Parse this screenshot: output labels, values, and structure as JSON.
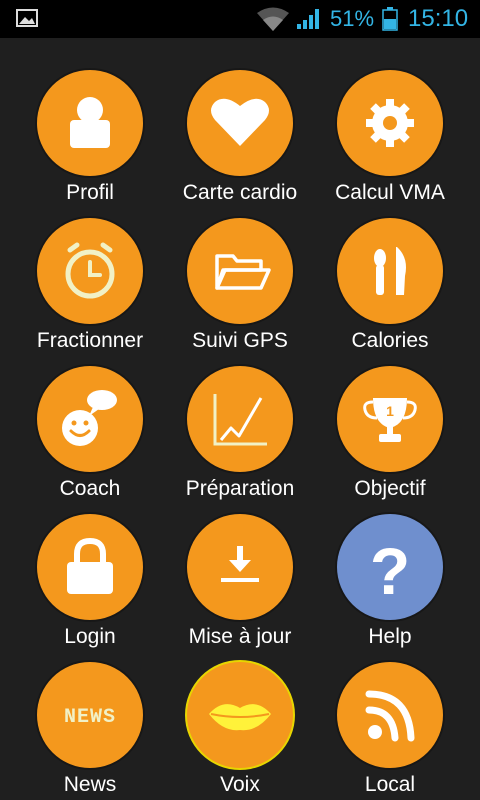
{
  "status_bar": {
    "battery_percent": "51%",
    "time": "15:10",
    "accent_color": "#33b5e5"
  },
  "colors": {
    "tile_orange": "#f4981d",
    "tile_blue": "#6f8fce",
    "background": "#1f1f1f"
  },
  "tiles": [
    {
      "label": "Profil",
      "icon": "user-icon"
    },
    {
      "label": "Carte cardio",
      "icon": "heart-icon"
    },
    {
      "label": "Calcul VMA",
      "icon": "gear-icon"
    },
    {
      "label": "Fractionner",
      "icon": "stopwatch-icon"
    },
    {
      "label": "Suivi GPS",
      "icon": "folder-icon"
    },
    {
      "label": "Calories",
      "icon": "cutlery-icon"
    },
    {
      "label": "Coach",
      "icon": "smiley-speech-icon"
    },
    {
      "label": "Préparation",
      "icon": "line-chart-icon"
    },
    {
      "label": "Objectif",
      "icon": "trophy-icon"
    },
    {
      "label": "Login",
      "icon": "lock-icon"
    },
    {
      "label": "Mise à jour",
      "icon": "download-icon"
    },
    {
      "label": "Help",
      "icon": "question-icon"
    },
    {
      "label": "News",
      "icon": "news-icon"
    },
    {
      "label": "Voix",
      "icon": "lips-icon"
    },
    {
      "label": "Local",
      "icon": "rss-icon"
    }
  ],
  "news_icon_text": "NEWS",
  "trophy_text": "1",
  "help_text": "?"
}
